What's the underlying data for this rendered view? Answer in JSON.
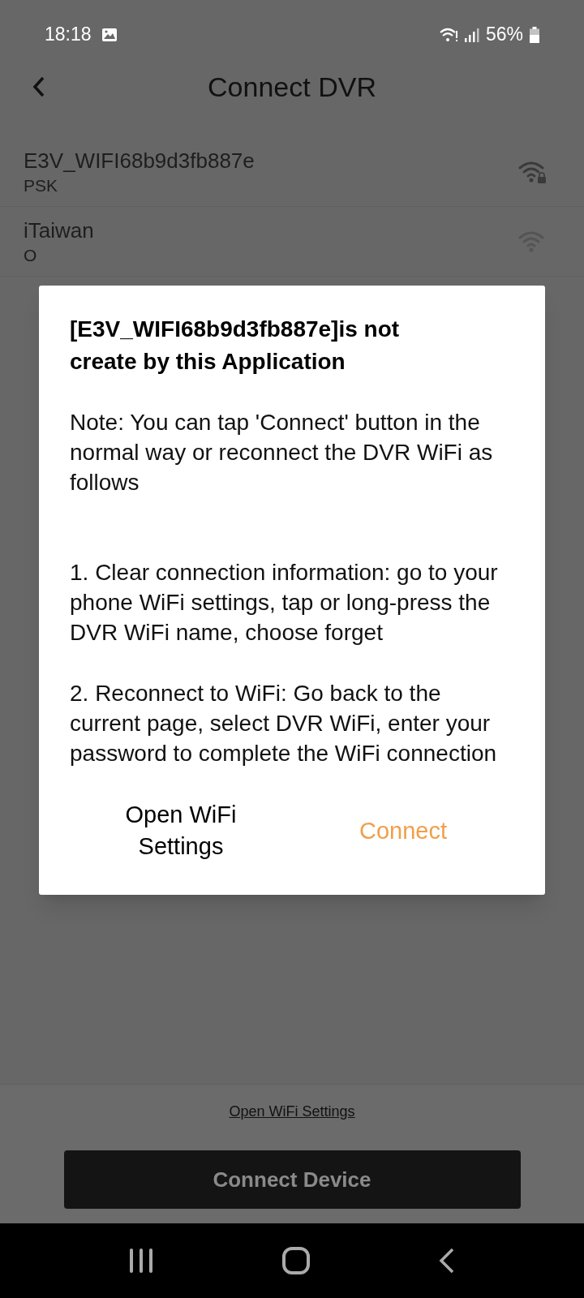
{
  "status_bar": {
    "time": "18:18",
    "battery": "56%"
  },
  "header": {
    "title": "Connect DVR"
  },
  "networks": [
    {
      "name": "E3V_WIFI68b9d3fb887e",
      "security": "PSK",
      "locked": true
    },
    {
      "name": "iTaiwan",
      "security": "O",
      "locked": false
    }
  ],
  "dialog": {
    "title": "[E3V_WIFI68b9d3fb887e]is not create by this Application",
    "paragraphs": [
      "Note: You can tap 'Connect' button in the normal way or reconnect the DVR WiFi as follows",
      "1. Clear connection information: go to your phone WiFi settings, tap or long-press the DVR WiFi name, choose forget",
      "2. Reconnect to WiFi: Go back to the current page, select DVR WiFi, enter your password to complete the WiFi connection"
    ],
    "buttons": [
      {
        "label": "Open WiFi Settings",
        "kind": "neutral"
      },
      {
        "label": "Connect",
        "kind": "accent"
      }
    ]
  },
  "footer": {
    "link": "Open WiFi Settings",
    "button": "Connect Device"
  }
}
